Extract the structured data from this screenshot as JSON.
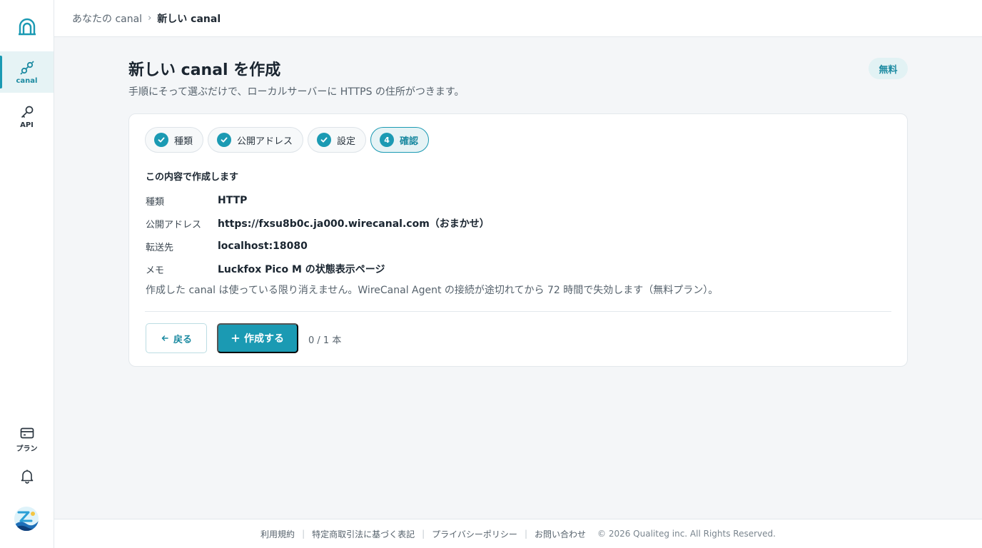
{
  "sidebar": {
    "items": [
      {
        "label": "canal",
        "icon": "link-icon"
      },
      {
        "label": "API",
        "icon": "key-icon"
      },
      {
        "label": "プラン",
        "icon": "credit-card-icon"
      }
    ]
  },
  "breadcrumb": {
    "parent": "あなたの canal",
    "separator": "›",
    "current": "新しい canal"
  },
  "page": {
    "title": "新しい canal を作成",
    "subtitle": "手順にそって選ぶだけで、ローカルサーバーに HTTPS の住所がつきます。",
    "badge": "無料"
  },
  "steps": [
    {
      "label": "種類",
      "state": "done"
    },
    {
      "label": "公開アドレス",
      "state": "done"
    },
    {
      "label": "設定",
      "state": "done"
    },
    {
      "label": "確認",
      "number": "4",
      "state": "active"
    }
  ],
  "confirm": {
    "heading": "この内容で作成します",
    "rows": [
      {
        "label": "種類",
        "value": "HTTP"
      },
      {
        "label": "公開アドレス",
        "value": "https://fxsu8b0c.ja000.wirecanal.com（おまかせ）"
      },
      {
        "label": "転送先",
        "value": "localhost:18080"
      },
      {
        "label": "メモ",
        "value": "Luckfox Pico M の状態表示ページ"
      }
    ],
    "note": "作成した canal は使っている限り消えません。WireCanal Agent の接続が途切れてから 72 時間で失効します（無料プラン）。"
  },
  "actions": {
    "back_label": "戻る",
    "create_label": "作成する",
    "count": "0 / 1 本"
  },
  "footer": {
    "links": [
      "利用規約",
      "特定商取引法に基づく表記",
      "プライバシーポリシー",
      "お問い合わせ"
    ],
    "separator": "|",
    "copyright": "© 2026 Qualiteg inc. All Rights Reserved."
  },
  "colors": {
    "accent": "#1b9ab3",
    "accent_soft": "#e6f3f5",
    "text": "#1a2530"
  }
}
